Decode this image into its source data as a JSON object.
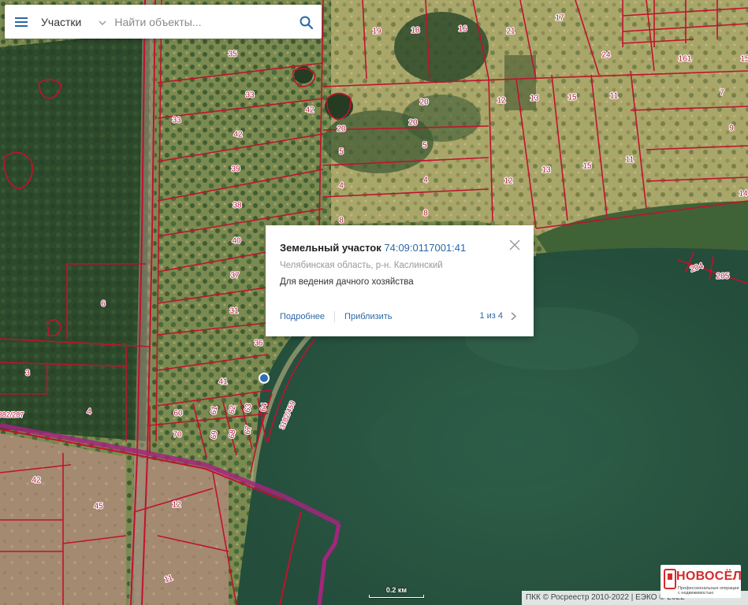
{
  "search": {
    "layer_label": "Участки",
    "placeholder": "Найти объекты..."
  },
  "icons": {
    "menu": "hamburger-icon",
    "chevron": "chevron-down-icon",
    "search": "search-icon",
    "close": "close-icon",
    "next": "chevron-right-icon",
    "marker": "location-dot-icon"
  },
  "popup": {
    "title": "Земельный участок",
    "cadastral_number": "74:09:0117001:41",
    "address": "Челябинская область, р-н. Каслинский",
    "purpose": "Для ведения дачного хозяйства",
    "more_link": "Подробнее",
    "zoom_link": "Приблизить",
    "pager": "1 из 4"
  },
  "map": {
    "scale_label": "0.2 км",
    "attribution": "ПКК © Росреестр 2010-2022 | ЕЭКО © 2022",
    "road_label": "3182/459",
    "parcel_labels": [
      "35",
      "19",
      "18",
      "16",
      "21",
      "17",
      "24",
      "161",
      "15",
      "33",
      "42",
      "20",
      "20",
      "12",
      "13",
      "15",
      "11",
      "7",
      "33",
      "42",
      "20",
      "5",
      "5",
      "9",
      "39",
      "4",
      "4",
      "12",
      "13",
      "15",
      "11",
      "8",
      "38",
      "8",
      "40",
      "37",
      "31",
      "36",
      "41",
      "6",
      "3",
      "4",
      "60",
      "61",
      "62",
      "63",
      "64",
      "70",
      "69",
      "68",
      "67",
      "42",
      "45",
      "12",
      "11",
      "204",
      "205",
      "14",
      "382/287"
    ]
  },
  "colors": {
    "parcel_border": "#c1122d",
    "road_border": "#b5103a",
    "boundary_purple": "#a3267d",
    "link_blue": "#2a67a6",
    "marker_blue": "#2f6fb5",
    "water": "#2c5a44"
  },
  "logo": {
    "text": "НОВОСЁЛ",
    "subtitle": "Профессиональные операции с недвижимостью"
  }
}
